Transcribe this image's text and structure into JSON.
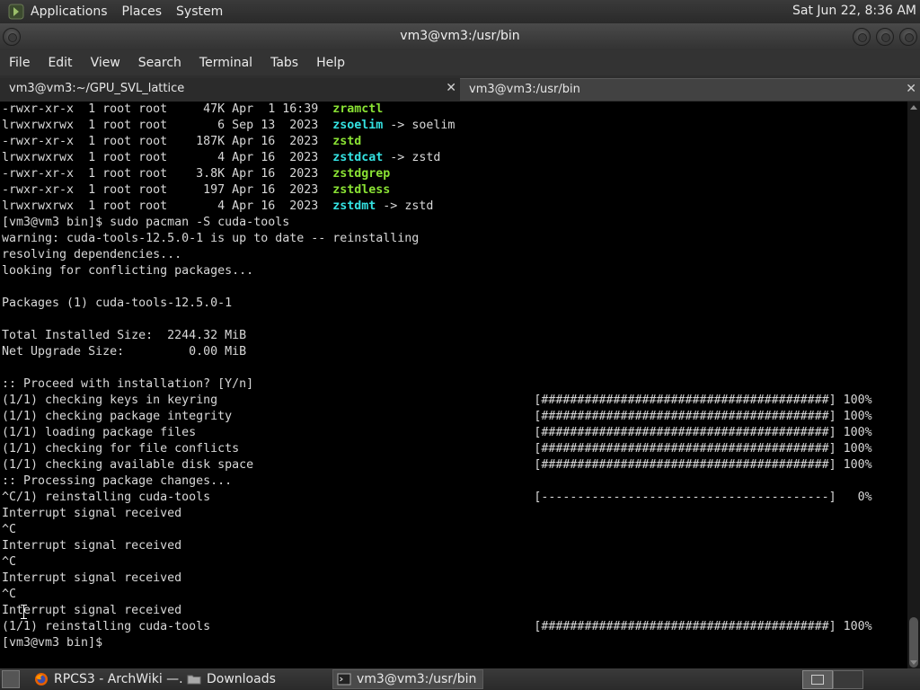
{
  "top_panel": {
    "menus": [
      "Applications",
      "Places",
      "System"
    ],
    "clock": "Sat Jun 22, 8:36 AM"
  },
  "window": {
    "title": "vm3@vm3:/usr/bin"
  },
  "menubar": [
    "File",
    "Edit",
    "View",
    "Search",
    "Terminal",
    "Tabs",
    "Help"
  ],
  "tabs": [
    {
      "label": "vm3@vm3:~/GPU_SVL_lattice",
      "close": "✕"
    },
    {
      "label": "vm3@vm3:/usr/bin",
      "close": "✕"
    }
  ],
  "terminal": {
    "lines": [
      {
        "text": "-rwxr-xr-x  1 root root     47K Apr  1 16:39  ",
        "name": "zramctl",
        "name_type": "exe",
        "suffix": ""
      },
      {
        "text": "lrwxrwxrwx  1 root root       6 Sep 13  2023  ",
        "name": "zsoelim",
        "name_type": "lnk",
        "suffix": " -> soelim"
      },
      {
        "text": "-rwxr-xr-x  1 root root    187K Apr 16  2023  ",
        "name": "zstd",
        "name_type": "exe",
        "suffix": ""
      },
      {
        "text": "lrwxrwxrwx  1 root root       4 Apr 16  2023  ",
        "name": "zstdcat",
        "name_type": "lnk",
        "suffix": " -> zstd"
      },
      {
        "text": "-rwxr-xr-x  1 root root    3.8K Apr 16  2023  ",
        "name": "zstdgrep",
        "name_type": "exe",
        "suffix": ""
      },
      {
        "text": "-rwxr-xr-x  1 root root     197 Apr 16  2023  ",
        "name": "zstdless",
        "name_type": "exe",
        "suffix": ""
      },
      {
        "text": "lrwxrwxrwx  1 root root       4 Apr 16  2023  ",
        "name": "zstdmt",
        "name_type": "lnk",
        "suffix": " -> zstd"
      },
      {
        "text": "[vm3@vm3 bin]$ sudo pacman -S cuda-tools"
      },
      {
        "text": "warning: cuda-tools-12.5.0-1 is up to date -- reinstalling"
      },
      {
        "text": "resolving dependencies..."
      },
      {
        "text": "looking for conflicting packages..."
      },
      {
        "text": ""
      },
      {
        "text": "Packages (1) cuda-tools-12.5.0-1"
      },
      {
        "text": ""
      },
      {
        "text": "Total Installed Size:  2244.32 MiB"
      },
      {
        "text": "Net Upgrade Size:         0.00 MiB"
      },
      {
        "text": ""
      },
      {
        "text": ":: Proceed with installation? [Y/n]"
      },
      {
        "text": "(1/1) checking keys in keyring                                            [########################################] 100%"
      },
      {
        "text": "(1/1) checking package integrity                                          [########################################] 100%"
      },
      {
        "text": "(1/1) loading package files                                               [########################################] 100%"
      },
      {
        "text": "(1/1) checking for file conflicts                                         [########################################] 100%"
      },
      {
        "text": "(1/1) checking available disk space                                       [########################################] 100%"
      },
      {
        "text": ":: Processing package changes..."
      },
      {
        "text": "^C/1) reinstalling cuda-tools                                             [----------------------------------------]   0%"
      },
      {
        "text": "Interrupt signal received"
      },
      {
        "text": "^C"
      },
      {
        "text": "Interrupt signal received"
      },
      {
        "text": "^C"
      },
      {
        "text": "Interrupt signal received"
      },
      {
        "text": "^C"
      },
      {
        "text": "Interrupt signal received"
      },
      {
        "text": "(1/1) reinstalling cuda-tools                                             [########################################] 100%"
      },
      {
        "text": "[vm3@vm3 bin]$ "
      }
    ]
  },
  "taskbar": {
    "tasks": [
      {
        "label": "RPCS3 - ArchWiki —...",
        "icon": "firefox-icon"
      },
      {
        "label": "Downloads",
        "icon": "folder-icon"
      },
      {
        "label": "vm3@vm3:/usr/bin",
        "icon": "terminal-icon"
      }
    ]
  },
  "colors": {
    "exe": "#8ae234",
    "lnk": "#34e2e2",
    "terminal_bg": "#000000",
    "terminal_fg": "#d8d8d8"
  }
}
